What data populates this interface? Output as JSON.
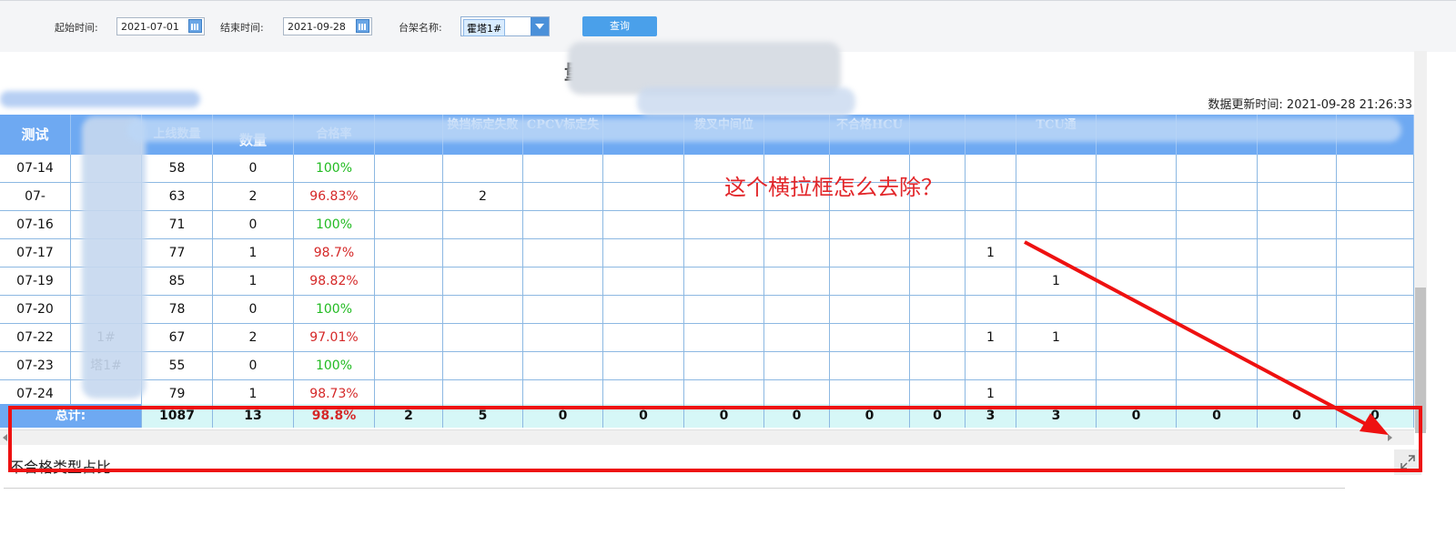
{
  "filter": {
    "start_label": "起始时间:",
    "start_value": "2021-07-01",
    "end_label": "结束时间:",
    "end_value": "2021-09-28",
    "rack_label": "台架名称:",
    "rack_value": "霍塔1#",
    "query_button": "查询"
  },
  "report": {
    "title": "量",
    "updated_text": "数据更新时间: 2021-09-28 21:26:33"
  },
  "table": {
    "headers": [
      "测试",
      "",
      "上线数量",
      "数量",
      "合格率",
      "",
      "换挡标定失败",
      "CPCV标定失",
      "",
      "拨叉中间位",
      "",
      "不合格HCU",
      "",
      "",
      "TCU通",
      "",
      "",
      "",
      ""
    ],
    "rows": [
      {
        "date": "07-14",
        "rack": "",
        "count": "58",
        "fail": "0",
        "rate": "100%",
        "rate_status": "green",
        "shift": "",
        "extra": [
          "",
          "",
          "",
          "",
          "",
          "",
          "",
          "",
          "",
          "",
          "",
          ""
        ]
      },
      {
        "date": "07-",
        "rack": "",
        "count": "63",
        "fail": "2",
        "rate": "96.83%",
        "rate_status": "red",
        "shift": "2",
        "extra": [
          "",
          "",
          "",
          "",
          "",
          "",
          "",
          "",
          "",
          "",
          "",
          ""
        ]
      },
      {
        "date": "07-16",
        "rack": "",
        "count": "71",
        "fail": "0",
        "rate": "100%",
        "rate_status": "green",
        "shift": "",
        "extra": [
          "",
          "",
          "",
          "",
          "",
          "",
          "",
          "",
          "",
          "",
          "",
          ""
        ]
      },
      {
        "date": "07-17",
        "rack": "",
        "count": "77",
        "fail": "1",
        "rate": "98.7%",
        "rate_status": "red",
        "shift": "",
        "extra": [
          "",
          "",
          "",
          "",
          "",
          "",
          "1",
          "",
          "",
          "",
          "",
          ""
        ]
      },
      {
        "date": "07-19",
        "rack": "",
        "count": "85",
        "fail": "1",
        "rate": "98.82%",
        "rate_status": "red",
        "shift": "",
        "extra": [
          "",
          "",
          "",
          "",
          "",
          "",
          "",
          "1",
          "",
          "",
          "",
          ""
        ]
      },
      {
        "date": "07-20",
        "rack": "",
        "count": "78",
        "fail": "0",
        "rate": "100%",
        "rate_status": "green",
        "shift": "",
        "extra": [
          "",
          "",
          "",
          "",
          "",
          "",
          "",
          "",
          "",
          "",
          "",
          ""
        ]
      },
      {
        "date": "07-22",
        "rack": "1#",
        "count": "67",
        "fail": "2",
        "rate": "97.01%",
        "rate_status": "red",
        "shift": "",
        "extra": [
          "",
          "",
          "",
          "",
          "",
          "",
          "1",
          "1",
          "",
          "",
          "",
          ""
        ]
      },
      {
        "date": "07-23",
        "rack": "塔1#",
        "count": "55",
        "fail": "0",
        "rate": "100%",
        "rate_status": "green",
        "shift": "",
        "extra": [
          "",
          "",
          "",
          "",
          "",
          "",
          "",
          "",
          "",
          "",
          "",
          ""
        ]
      },
      {
        "date": "07-24",
        "rack": "",
        "count": "79",
        "fail": "1",
        "rate": "98.73%",
        "rate_status": "red",
        "shift": "",
        "extra": [
          "",
          "",
          "",
          "",
          "",
          "",
          "1",
          "",
          "",
          "",
          "",
          ""
        ]
      }
    ],
    "total": {
      "label": "总计:",
      "values": [
        "1087",
        "13",
        "98.8%",
        "2",
        "5",
        "0",
        "0",
        "0",
        "0",
        "0",
        "0",
        "3",
        "3",
        "0",
        "0",
        "0",
        "0"
      ]
    }
  },
  "section": {
    "title": "不合格类型占比"
  },
  "annotation": {
    "text": "这个横拉框怎么去除？",
    "color": "#e2262a"
  },
  "colors": {
    "header_bg": "#6ea9f2",
    "total_bg": "#d6f7f7",
    "pass": "#22bb22",
    "fail": "#d52828",
    "annotation": "#ee1111"
  }
}
